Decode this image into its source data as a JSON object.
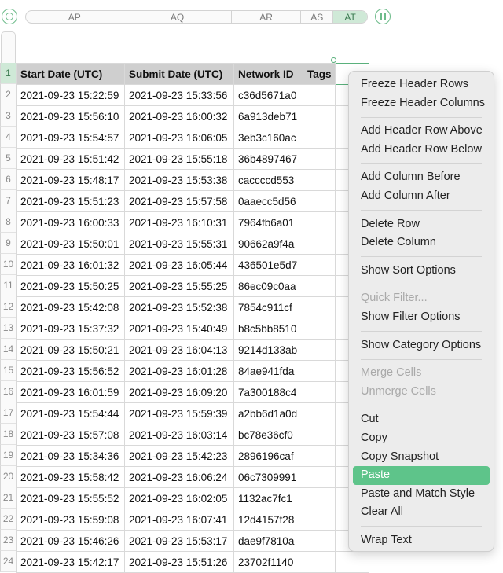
{
  "toolbar": {
    "left_button_icon": "circle-icon",
    "right_button_icon": "pause-icon",
    "columns": [
      {
        "label": "AP",
        "selected": false
      },
      {
        "label": "AQ",
        "selected": false
      },
      {
        "label": "AR",
        "selected": false
      },
      {
        "label": "AS",
        "selected": false
      },
      {
        "label": "AT",
        "selected": true
      }
    ]
  },
  "table": {
    "row_numbers": [
      "1",
      "2",
      "3",
      "4",
      "5",
      "6",
      "7",
      "8",
      "9",
      "10",
      "11",
      "12",
      "13",
      "14",
      "15",
      "16",
      "17",
      "18",
      "19",
      "20",
      "21",
      "22",
      "23",
      "24"
    ],
    "headers": [
      "Start Date (UTC)",
      "Submit Date (UTC)",
      "Network ID",
      "Tags",
      ""
    ],
    "rows": [
      [
        "2021-09-23 15:22:59",
        "2021-09-23 15:33:56",
        "c36d5671a0"
      ],
      [
        "2021-09-23 15:56:10",
        "2021-09-23 16:00:32",
        "6a913deb71"
      ],
      [
        "2021-09-23 15:54:57",
        "2021-09-23 16:06:05",
        "3eb3c160ac"
      ],
      [
        "2021-09-23 15:51:42",
        "2021-09-23 15:55:18",
        "36b4897467"
      ],
      [
        "2021-09-23 15:48:17",
        "2021-09-23 15:53:38",
        "caccccd553"
      ],
      [
        "2021-09-23 15:51:23",
        "2021-09-23 15:57:58",
        "0aaecc5d56"
      ],
      [
        "2021-09-23 16:00:33",
        "2021-09-23 16:10:31",
        "7964fb6a01"
      ],
      [
        "2021-09-23 15:50:01",
        "2021-09-23 15:55:31",
        "90662a9f4a"
      ],
      [
        "2021-09-23 16:01:32",
        "2021-09-23 16:05:44",
        "436501e5d7"
      ],
      [
        "2021-09-23 15:50:25",
        "2021-09-23 15:55:25",
        "86ec09c0aa"
      ],
      [
        "2021-09-23 15:42:08",
        "2021-09-23 15:52:38",
        "7854c911cf"
      ],
      [
        "2021-09-23 15:37:32",
        "2021-09-23 15:40:49",
        "b8c5bb8510"
      ],
      [
        "2021-09-23 15:50:21",
        "2021-09-23 16:04:13",
        "9214d133ab"
      ],
      [
        "2021-09-23 15:56:52",
        "2021-09-23 16:01:28",
        "84ae941fda"
      ],
      [
        "2021-09-23 16:01:59",
        "2021-09-23 16:09:20",
        "7a300188c4"
      ],
      [
        "2021-09-23 15:54:44",
        "2021-09-23 15:59:39",
        "a2bb6d1a0d"
      ],
      [
        "2021-09-23 15:57:08",
        "2021-09-23 16:03:14",
        "bc78e36cf0"
      ],
      [
        "2021-09-23 15:34:36",
        "2021-09-23 15:42:23",
        "2896196caf"
      ],
      [
        "2021-09-23 15:58:42",
        "2021-09-23 16:06:24",
        "06c7309991"
      ],
      [
        "2021-09-23 15:55:52",
        "2021-09-23 16:02:05",
        "1132ac7fc1"
      ],
      [
        "2021-09-23 15:59:08",
        "2021-09-23 16:07:41",
        "12d4157f28"
      ],
      [
        "2021-09-23 15:46:26",
        "2021-09-23 15:53:17",
        "dae9f7810a"
      ],
      [
        "2021-09-23 15:42:17",
        "2021-09-23 15:51:26",
        "23702f1140"
      ]
    ]
  },
  "context_menu": {
    "groups": [
      [
        {
          "label": "Freeze Header Rows"
        },
        {
          "label": "Freeze Header Columns"
        }
      ],
      [
        {
          "label": "Add Header Row Above"
        },
        {
          "label": "Add Header Row Below"
        }
      ],
      [
        {
          "label": "Add Column Before"
        },
        {
          "label": "Add Column After"
        }
      ],
      [
        {
          "label": "Delete Row"
        },
        {
          "label": "Delete Column"
        }
      ],
      [
        {
          "label": "Show Sort Options"
        }
      ],
      [
        {
          "label": "Quick Filter...",
          "disabled": true
        },
        {
          "label": "Show Filter Options"
        }
      ],
      [
        {
          "label": "Show Category Options"
        }
      ],
      [
        {
          "label": "Merge Cells",
          "disabled": true
        },
        {
          "label": "Unmerge Cells",
          "disabled": true
        }
      ],
      [
        {
          "label": "Cut"
        },
        {
          "label": "Copy"
        },
        {
          "label": "Copy Snapshot"
        },
        {
          "label": "Paste",
          "highlighted": true
        },
        {
          "label": "Paste and Match Style"
        },
        {
          "label": "Clear All"
        }
      ],
      [
        {
          "label": "Wrap Text"
        }
      ]
    ]
  },
  "colors": {
    "accent": "#5ec48a",
    "selection_fill": "#cfe9d7",
    "header_fill": "#cfcfcf"
  }
}
